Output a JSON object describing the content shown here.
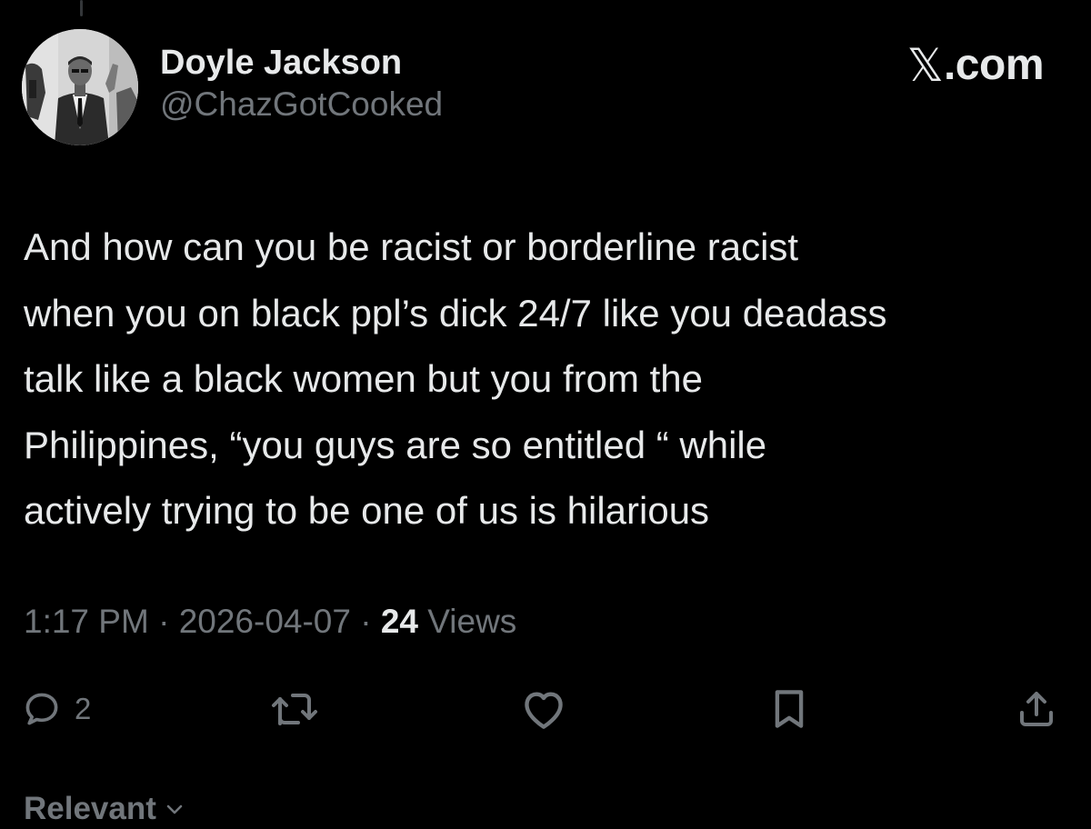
{
  "author": {
    "display_name": "Doyle Jackson",
    "handle": "@ChazGotCooked"
  },
  "brand": {
    "x_icon": "x-logo-icon",
    "text": ".com"
  },
  "post": {
    "lines": [
      "And how can you be racist or borderline racist",
      "when you on black ppl’s dick 24/7 like you deadass",
      "talk like a black women but you from the",
      "Philippines, “you guys are so entitled “ while",
      "actively trying to be one of us is hilarious"
    ]
  },
  "meta": {
    "time": "1:17 PM",
    "separator": " · ",
    "date": "2026-04-07",
    "views_count": "24",
    "views_label": " Views"
  },
  "actions": {
    "reply_count": "2",
    "icons": [
      "reply-icon",
      "repost-icon",
      "like-icon",
      "bookmark-icon",
      "share-icon"
    ]
  },
  "sort": {
    "label": "Relevant",
    "icon": "chevron-down-icon"
  },
  "colors": {
    "background": "#000000",
    "primary_text": "#e7e9ea",
    "secondary_text": "#71767b"
  }
}
